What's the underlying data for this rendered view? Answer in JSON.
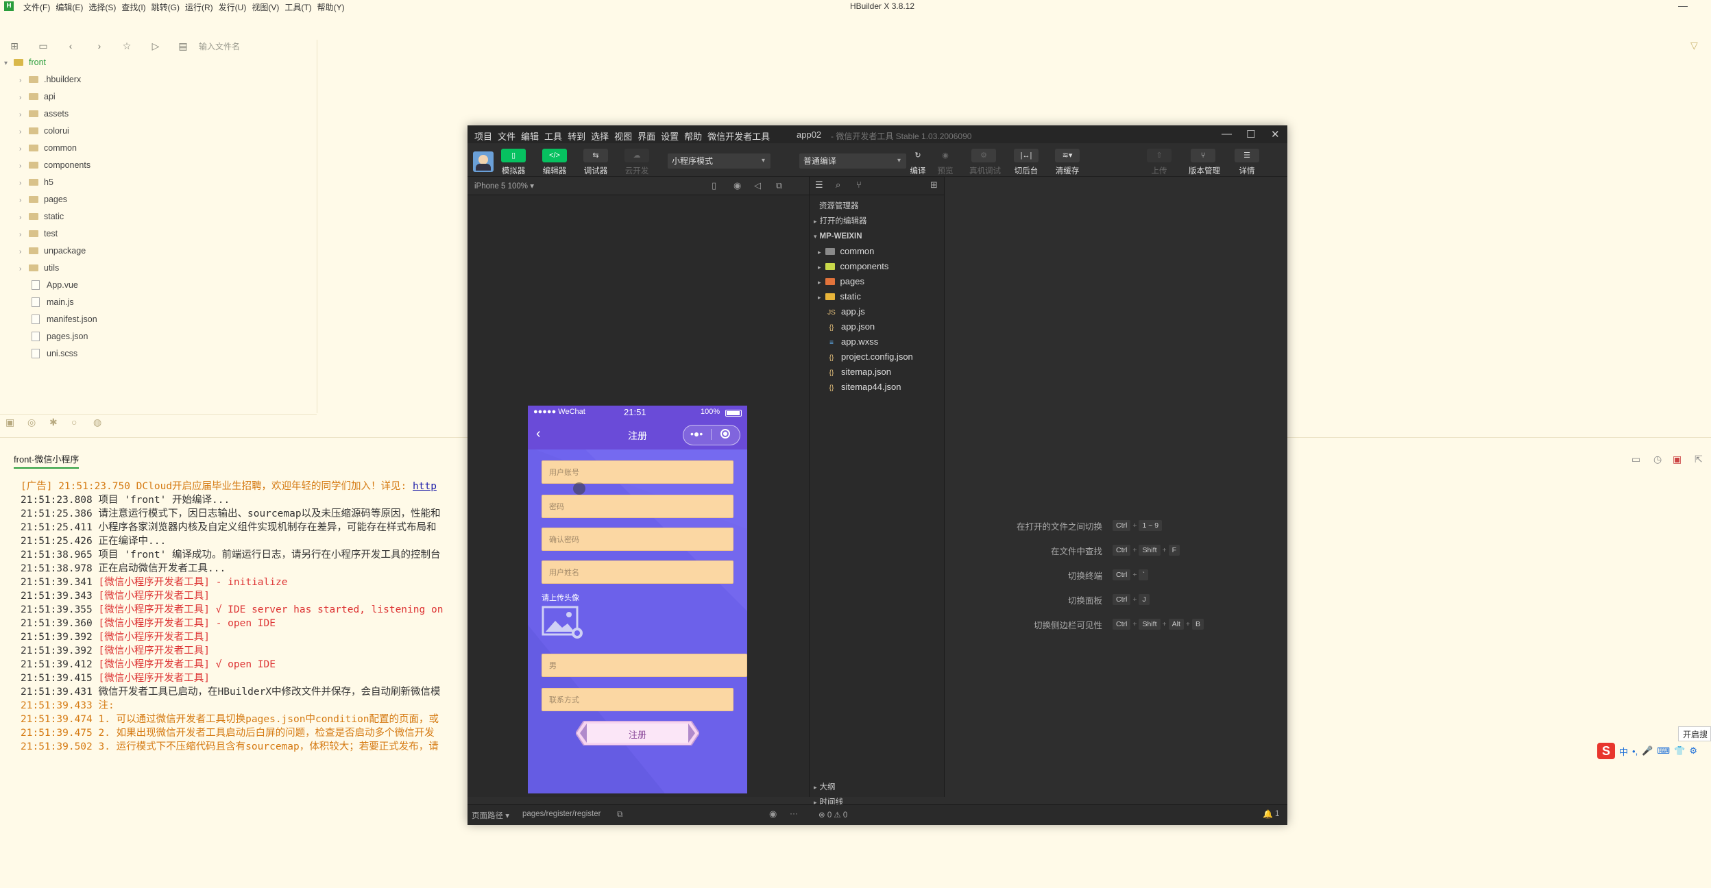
{
  "hbuilder": {
    "menus": [
      "文件(F)",
      "编辑(E)",
      "选择(S)",
      "查找(I)",
      "跳转(G)",
      "运行(R)",
      "发行(U)",
      "视图(V)",
      "工具(T)",
      "帮助(Y)"
    ],
    "title": "HBuilder X 3.8.12",
    "search_placeholder": "输入文件名",
    "explorer": {
      "project": "front",
      "folders": [
        ".hbuilderx",
        "api",
        "assets",
        "colorui",
        "common",
        "components",
        "h5",
        "pages",
        "static",
        "test",
        "unpackage",
        "utils"
      ],
      "files": [
        "App.vue",
        "main.js",
        "manifest.json",
        "pages.json",
        "uni.scss"
      ]
    },
    "console": {
      "tab": "front-微信小程序",
      "lines": [
        {
          "text": "[广告] 21:51:23.750 DCloud开启应届毕业生招聘，欢迎年轻的同学们加入！详见: ",
          "link": "http",
          "color": "orange"
        },
        {
          "text": "21:51:23.808 项目 'front' 开始编译...",
          "color": "normal"
        },
        {
          "text": "21:51:25.386 请注意运行模式下，因日志输出、sourcemap以及未压缩源码等原因，性能和",
          "color": "normal"
        },
        {
          "text": "21:51:25.411 小程序各家浏览器内核及自定义组件实现机制存在差异，可能存在样式布局和",
          "color": "normal"
        },
        {
          "text": "21:51:25.426 正在编译中...",
          "color": "normal"
        },
        {
          "text": "21:51:38.965 项目 'front' 编译成功。前端运行日志，请另行在小程序开发工具的控制台",
          "color": "normal"
        },
        {
          "text": "21:51:38.978 正在启动微信开发者工具...",
          "color": "normal"
        },
        {
          "text": "21:51:39.341 [微信小程序开发者工具] - initialize",
          "color": "mixed"
        },
        {
          "text": "21:51:39.343 [微信小程序开发者工具]",
          "color": "mixed"
        },
        {
          "text": "21:51:39.355 [微信小程序开发者工具] √ IDE server has started, listening on",
          "color": "mixed"
        },
        {
          "text": "21:51:39.360 [微信小程序开发者工具] - open IDE",
          "color": "mixed"
        },
        {
          "text": "21:51:39.392 [微信小程序开发者工具]",
          "color": "mixed"
        },
        {
          "text": "21:51:39.392 [微信小程序开发者工具]",
          "color": "mixed"
        },
        {
          "text": "21:51:39.412 [微信小程序开发者工具] √ open IDE",
          "color": "mixed"
        },
        {
          "text": "21:51:39.415 [微信小程序开发者工具]",
          "color": "mixed"
        },
        {
          "text": "21:51:39.431 微信开发者工具已启动，在HBuilderX中修改文件并保存，会自动刷新微信模",
          "color": "normal"
        },
        {
          "text": "21:51:39.433 注:",
          "color": "orange"
        },
        {
          "text": "21:51:39.474 1. 可以通过微信开发者工具切换pages.json中condition配置的页面，或",
          "color": "orange"
        },
        {
          "text": "21:51:39.475 2. 如果出现微信开发者工具启动后白屏的问题，检查是否启动多个微信开发",
          "color": "orange"
        },
        {
          "text": "21:51:39.502 3. 运行模式下不压缩代码且含有sourcemap，体积较大；若要正式发布，请",
          "color": "orange"
        }
      ]
    }
  },
  "wechat": {
    "menus": [
      "项目",
      "文件",
      "编辑",
      "工具",
      "转到",
      "选择",
      "视图",
      "界面",
      "设置",
      "帮助",
      "微信开发者工具"
    ],
    "app_name": "app02",
    "version": "- 微信开发者工具 Stable 1.03.2006090",
    "tools": {
      "simulator": "模拟器",
      "editor": "编辑器",
      "debugger": "调试器",
      "cloud": "云开发",
      "mode": "小程序模式",
      "compile_mode": "普通编译",
      "compile": "编译",
      "preview": "预览",
      "remote_debug": "真机调试",
      "switch_backend": "切后台",
      "clear_cache": "清缓存",
      "upload": "上传",
      "version_mgmt": "版本管理",
      "details": "详情"
    },
    "device": "iPhone 5 100% ▾",
    "phone": {
      "carrier": "●●●●● WeChat",
      "time": "21:51",
      "battery": "100%",
      "nav_title": "注册",
      "fields": [
        "用户账号",
        "密码",
        "确认密码",
        "用户姓名"
      ],
      "avatar_label": "请上传头像",
      "gender": "男",
      "contact": "联系方式",
      "submit": "注册"
    },
    "explorer": {
      "title": "资源管理器",
      "open_editors": "打开的编辑器",
      "root": "MP-WEIXIN",
      "folders": [
        "common",
        "components",
        "pages",
        "static"
      ],
      "files": [
        "app.js",
        "app.json",
        "app.wxss",
        "project.config.json",
        "sitemap.json",
        "sitemap44.json"
      ],
      "outline": "大纲",
      "timeline": "时间线"
    },
    "shortcuts": [
      {
        "label": "在打开的文件之间切换",
        "keys": [
          "Ctrl",
          "1 ~ 9"
        ]
      },
      {
        "label": "在文件中查找",
        "keys": [
          "Ctrl",
          "Shift",
          "F"
        ]
      },
      {
        "label": "切换终端",
        "keys": [
          "Ctrl",
          "`"
        ]
      },
      {
        "label": "切换面板",
        "keys": [
          "Ctrl",
          "J"
        ]
      },
      {
        "label": "切换侧边栏可见性",
        "keys": [
          "Ctrl",
          "Shift",
          "Alt",
          "B"
        ]
      }
    ],
    "status": {
      "page_path_label": "页面路径 ▾",
      "page_path": "pages/register/register",
      "problems": "⊗ 0 ⚠ 0",
      "notifications": "1"
    }
  },
  "ime": {
    "tip": "开启搜",
    "items": [
      "中",
      "•,",
      "🎤",
      "⌨",
      "👕",
      "⚙"
    ]
  }
}
